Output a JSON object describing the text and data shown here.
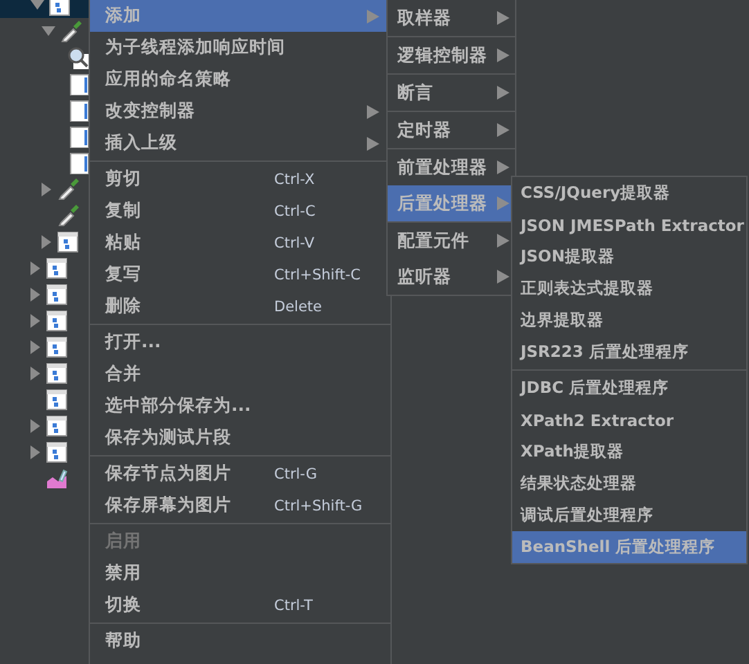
{
  "tree": [
    {
      "kind": "plan",
      "expanded": true,
      "selected": true,
      "children": [
        {
          "kind": "dropper",
          "expanded": true,
          "selected": false,
          "children": [
            {
              "kind": "magnifier",
              "selected": false
            },
            {
              "kind": "doc",
              "selected": false
            },
            {
              "kind": "doc",
              "selected": false
            },
            {
              "kind": "doc",
              "selected": false
            },
            {
              "kind": "doc",
              "selected": false
            }
          ]
        },
        {
          "kind": "dropper",
          "expanded": false,
          "selected": false
        },
        {
          "kind": "dropper",
          "selected": false
        },
        {
          "kind": "plan",
          "expanded": false,
          "selected": false
        }
      ]
    },
    {
      "kind": "plan",
      "expanded": false,
      "selected": false
    },
    {
      "kind": "plan",
      "expanded": false,
      "selected": false
    },
    {
      "kind": "plan",
      "expanded": false,
      "selected": false
    },
    {
      "kind": "plan",
      "expanded": false,
      "selected": false
    },
    {
      "kind": "plan",
      "expanded": false,
      "selected": false
    },
    {
      "kind": "plan",
      "selected": false
    },
    {
      "kind": "plan",
      "expanded": false,
      "selected": false
    },
    {
      "kind": "plan",
      "expanded": false,
      "selected": false
    },
    {
      "kind": "chart",
      "selected": false
    }
  ],
  "context_menu": [
    {
      "kind": "item",
      "label": "添加",
      "submenu": true,
      "selected": true,
      "disabled": false
    },
    {
      "kind": "item",
      "label": "为子线程添加响应时间",
      "submenu": false,
      "selected": false,
      "disabled": false
    },
    {
      "kind": "item",
      "label": "应用的命名策略",
      "submenu": false,
      "selected": false,
      "disabled": false
    },
    {
      "kind": "item",
      "label": "改变控制器",
      "submenu": true,
      "selected": false,
      "disabled": false
    },
    {
      "kind": "item",
      "label": "插入上级",
      "submenu": true,
      "selected": false,
      "disabled": false
    },
    {
      "kind": "separator"
    },
    {
      "kind": "item",
      "label": "剪切",
      "shortcut": "Ctrl-X",
      "submenu": false,
      "selected": false,
      "disabled": false
    },
    {
      "kind": "item",
      "label": "复制",
      "shortcut": "Ctrl-C",
      "submenu": false,
      "selected": false,
      "disabled": false
    },
    {
      "kind": "item",
      "label": "粘贴",
      "shortcut": "Ctrl-V",
      "submenu": false,
      "selected": false,
      "disabled": false
    },
    {
      "kind": "item",
      "label": "复写",
      "shortcut": "Ctrl+Shift-C",
      "submenu": false,
      "selected": false,
      "disabled": false
    },
    {
      "kind": "item",
      "label": "删除",
      "shortcut": "Delete",
      "submenu": false,
      "selected": false,
      "disabled": false
    },
    {
      "kind": "separator"
    },
    {
      "kind": "item",
      "label": "打开...",
      "submenu": false,
      "selected": false,
      "disabled": false
    },
    {
      "kind": "item",
      "label": "合并",
      "submenu": false,
      "selected": false,
      "disabled": false
    },
    {
      "kind": "item",
      "label": "选中部分保存为...",
      "submenu": false,
      "selected": false,
      "disabled": false
    },
    {
      "kind": "item",
      "label": "保存为测试片段",
      "submenu": false,
      "selected": false,
      "disabled": false
    },
    {
      "kind": "separator"
    },
    {
      "kind": "item",
      "label": "保存节点为图片",
      "shortcut": "Ctrl-G",
      "submenu": false,
      "selected": false,
      "disabled": false
    },
    {
      "kind": "item",
      "label": "保存屏幕为图片",
      "shortcut": "Ctrl+Shift-G",
      "submenu": false,
      "selected": false,
      "disabled": false
    },
    {
      "kind": "separator"
    },
    {
      "kind": "item",
      "label": "启用",
      "submenu": false,
      "selected": false,
      "disabled": true
    },
    {
      "kind": "item",
      "label": "禁用",
      "submenu": false,
      "selected": false,
      "disabled": false
    },
    {
      "kind": "item",
      "label": "切换",
      "shortcut": "Ctrl-T",
      "submenu": false,
      "selected": false,
      "disabled": false
    },
    {
      "kind": "separator"
    },
    {
      "kind": "item",
      "label": "帮助",
      "submenu": false,
      "selected": false,
      "disabled": false
    }
  ],
  "add_submenu": [
    {
      "kind": "item",
      "label": "取样器",
      "submenu": true,
      "selected": false
    },
    {
      "kind": "separator"
    },
    {
      "kind": "item",
      "label": "逻辑控制器",
      "submenu": true,
      "selected": false
    },
    {
      "kind": "separator"
    },
    {
      "kind": "item",
      "label": "断言",
      "submenu": true,
      "selected": false
    },
    {
      "kind": "separator"
    },
    {
      "kind": "item",
      "label": "定时器",
      "submenu": true,
      "selected": false
    },
    {
      "kind": "separator"
    },
    {
      "kind": "item",
      "label": "前置处理器",
      "submenu": true,
      "selected": false
    },
    {
      "kind": "item",
      "label": "后置处理器",
      "submenu": true,
      "selected": true
    },
    {
      "kind": "separator"
    },
    {
      "kind": "item",
      "label": "配置元件",
      "submenu": true,
      "selected": false
    },
    {
      "kind": "item",
      "label": "监听器",
      "submenu": true,
      "selected": false
    }
  ],
  "post_processor_submenu": [
    {
      "kind": "item",
      "label": "CSS/JQuery提取器",
      "selected": false
    },
    {
      "kind": "item",
      "label": "JSON JMESPath Extractor",
      "selected": false
    },
    {
      "kind": "item",
      "label": "JSON提取器",
      "selected": false
    },
    {
      "kind": "item",
      "label": "正则表达式提取器",
      "selected": false
    },
    {
      "kind": "item",
      "label": "边界提取器",
      "selected": false
    },
    {
      "kind": "item",
      "label": "JSR223 后置处理程序",
      "selected": false
    },
    {
      "kind": "separator"
    },
    {
      "kind": "item",
      "label": "JDBC 后置处理程序",
      "selected": false
    },
    {
      "kind": "item",
      "label": "XPath2 Extractor",
      "selected": false
    },
    {
      "kind": "item",
      "label": "XPath提取器",
      "selected": false
    },
    {
      "kind": "item",
      "label": "结果状态处理器",
      "selected": false
    },
    {
      "kind": "item",
      "label": "调试后置处理程序",
      "selected": false
    },
    {
      "kind": "item",
      "label": "BeanShell 后置处理程序",
      "selected": true
    }
  ]
}
